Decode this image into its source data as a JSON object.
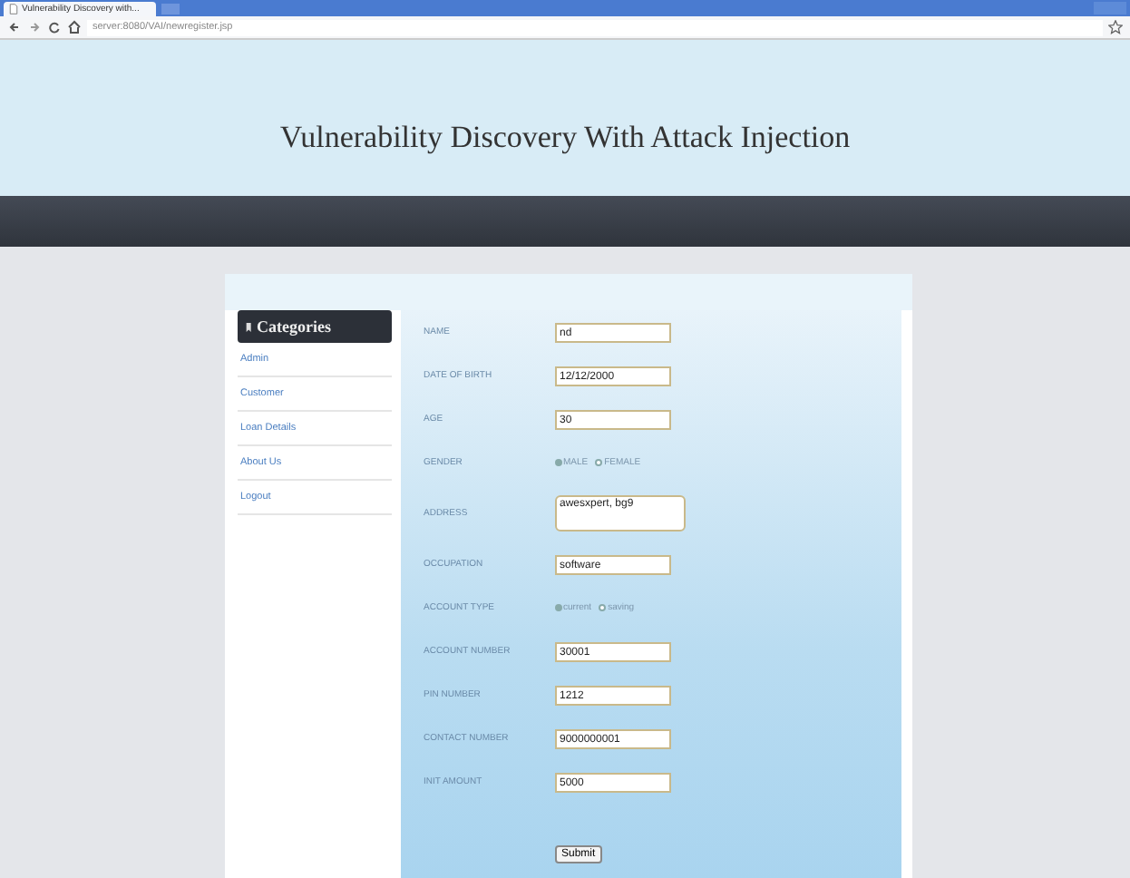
{
  "browser": {
    "tab_title": "Vulnerability Discovery with...",
    "url": "server:8080/VAI/newregister.jsp"
  },
  "header": {
    "title": "Vulnerability Discovery With Attack Injection"
  },
  "sidebar": {
    "title": "Categories",
    "items": [
      {
        "label": "Admin"
      },
      {
        "label": "Customer"
      },
      {
        "label": "Loan Details"
      },
      {
        "label": "About Us"
      },
      {
        "label": "Logout"
      }
    ]
  },
  "form": {
    "fields": [
      {
        "kind": "text",
        "label": "NAME",
        "value": "nd"
      },
      {
        "kind": "text",
        "label": "DATE OF BIRTH",
        "value": "12/12/2000"
      },
      {
        "kind": "text",
        "label": "AGE",
        "value": "30"
      },
      {
        "kind": "radio",
        "label": "GENDER",
        "options": [
          {
            "label": "MALE",
            "selected": true
          },
          {
            "label": "FEMALE",
            "selected": false
          }
        ]
      },
      {
        "kind": "textarea",
        "label": "ADDRESS",
        "value": "awesxpert, bg9"
      },
      {
        "kind": "text",
        "label": "OCCUPATION",
        "value": "software"
      },
      {
        "kind": "radio",
        "label": "ACCOUNT TYPE",
        "options": [
          {
            "label": "current",
            "selected": true
          },
          {
            "label": "saving",
            "selected": false
          }
        ]
      },
      {
        "kind": "text",
        "label": "ACCOUNT NUMBER",
        "value": "30001"
      },
      {
        "kind": "text",
        "label": "PIN NUMBER",
        "value": "1212"
      },
      {
        "kind": "text",
        "label": "CONTACT NUMBER",
        "value": "9000000001"
      },
      {
        "kind": "text",
        "label": "INIT AMOUNT",
        "value": "5000"
      }
    ],
    "submit": "Submit"
  }
}
